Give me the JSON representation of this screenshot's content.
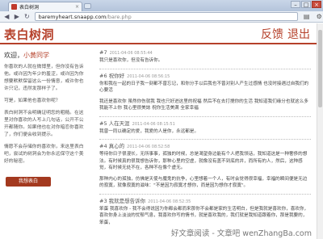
{
  "browser": {
    "tab_title": "表白树洞",
    "url_domain": "baremyheart.snaapp.com",
    "url_path": "/bare.php",
    "tab_close": "×",
    "controls": {
      "minimize": "–",
      "maximize": "□",
      "close": "×"
    },
    "icons": {
      "back": "back-arrow-icon",
      "forward": "forward-arrow-icon",
      "reload": "reload-icon",
      "page": "page-menu-icon",
      "tools": "wrench-icon"
    }
  },
  "site": {
    "title": "表白树洞",
    "nav": {
      "feedback": "反馈",
      "logout": "退出"
    }
  },
  "sidebar": {
    "welcome_prefix": "欢迎，",
    "welcome_user": "小黄同学",
    "paragraphs": [
      "你喜欢的人就在微博里，但你没有告诉他。或许因为年少的羞涩，或许因为你想要默默保留这么一份情意，或许你也许只记，违然发那样子了。",
      "可是，如果他也喜欢你呢？",
      "表白树洞不会明确证明您的粗糙。在这里对你喜欢的人写上几句话，公开不公开都随你。如果他也在对你暗恋你喜欢了，你们便会收到提示。",
      "情愿不会存储你的喜欢你，来这里表白吧，尝试的树洞会为你永远保守这个美好的秘密。"
    ],
    "love_button": "我想表白"
  },
  "posts": [
    {
      "author": "#7",
      "time": "2011-04-06 08:55:44",
      "body": "我只是喜欢你，但没有告诉你。"
    },
    {
      "author": "#6 祝你好",
      "time": "2011-04-06 08:56:15",
      "body": "你和我在一起的日子我一刻都不曾忘记，和你分手以后我也不曾对别人产生过感情 也没时接遇过自我们的心要活"
    },
    {
      "author": "",
      "time": "",
      "body": "我还是喜欢你 虽然你伤就我 我也只好进这里的祝福 然后不在去打搅你的生活 我知道我们缘分也就这么多 我能不上你 我心里很美誌 祝你生活美满 全家幸福"
    },
    {
      "author": "#5 人在天涯",
      "time": "2011-04-06 08:15:51",
      "body": "我曾一同以确定的爱，我爱的人是你，永远都是。"
    },
    {
      "author": "#4 真心的",
      "time": "2011-04-06 08:52:58",
      "body": "等待你日子很漫长，无所事事，孤独的时候，总是渴望身边能有个人把我领话，我知道这是一种奢侈的想法。有时候真的很我想告诉你，那种心里的空虚，就像没有盖不到底的井，而所有的人，然后，这种感觉，有时候无处不在，各种不在像个虚无。"
    },
    {
      "author": "",
      "time": "",
      "body": "那种内心的孤独，仿佛是天使与魔鬼的抗争，心里想着一个人，有时会觉得很幸福，幸福的瞬间便是无边的寂寞，就像寂寞的滋味：\"不是因为寂寞才想你，而是因为想你才寂寞\"。"
    },
    {
      "author": "#3 我就是想告诉你",
      "time": "2011-04-06 08:52:35",
      "body": "笨蛋 我喜欢你 - 我不会得说因为你都会都而来那你不会都是家的生活明白，但是我就是喜欢你，喜欢你，喜欢你身上淡淡的忧郁气息，我喜欢你写的情书，就是喜欢我的，我们就是我知道跟着你，那是我要的，笨蛋，"
    }
  ],
  "watermark": "好文章阅读 - 文章吧 wenZhangBa.com"
}
